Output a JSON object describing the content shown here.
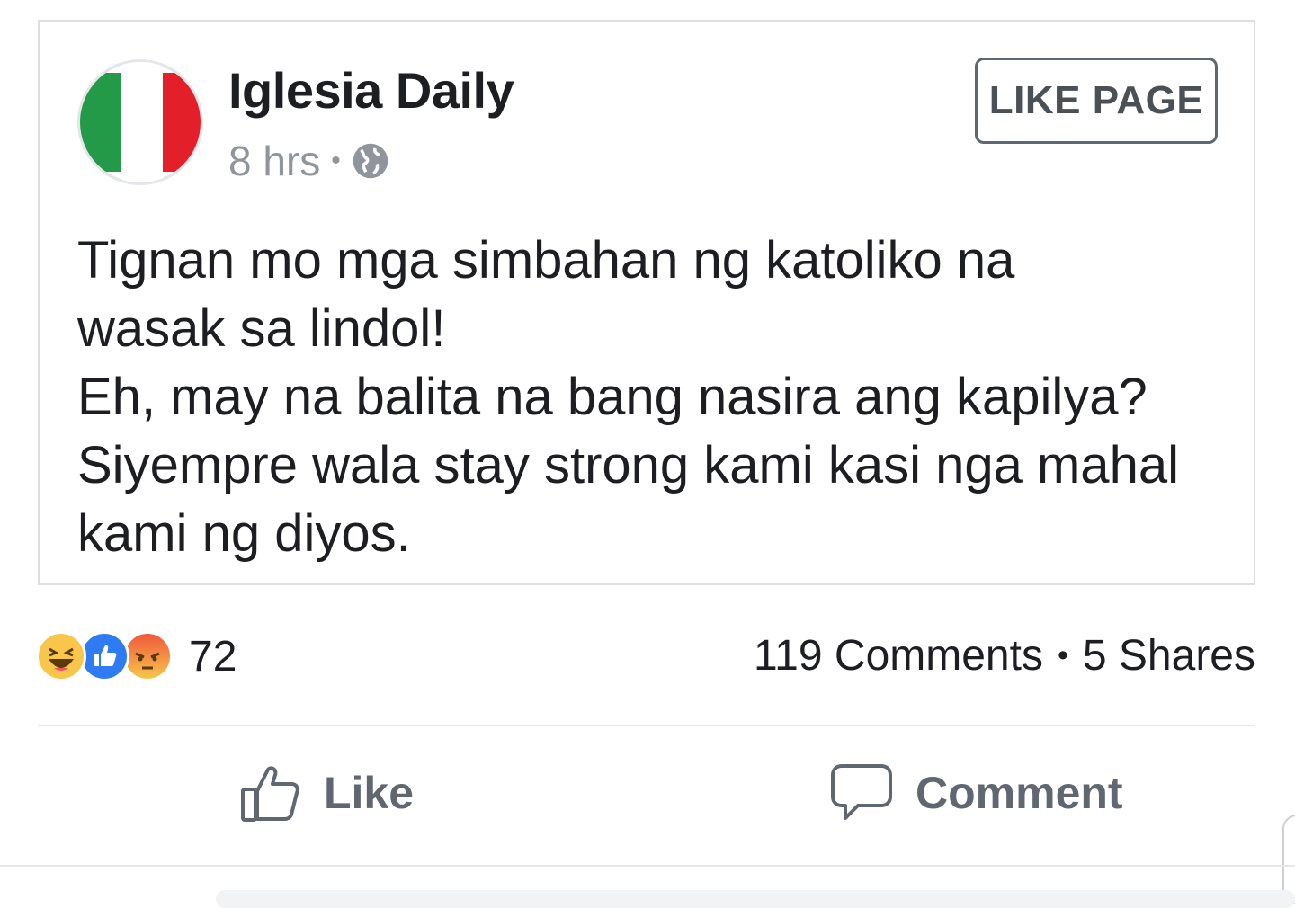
{
  "post": {
    "page_name": "Iglesia Daily",
    "time": "8 hrs",
    "separator": "•",
    "privacy_icon": "globe-icon",
    "like_page_label": "LIKE PAGE",
    "text_lines": [
      "Tignan mo mga simbahan ng katoliko na",
      "wasak sa lindol!",
      "Eh, may na balita na bang nasira ang kapilya?",
      "Siyempre wala stay strong kami kasi nga mahal",
      "kami ng diyos."
    ]
  },
  "engagement": {
    "reaction_icons": [
      "haha-icon",
      "like-icon",
      "angry-icon"
    ],
    "reaction_count": "72",
    "comments": "119 Comments",
    "separator": "•",
    "shares": "5 Shares"
  },
  "actions": {
    "like_label": "Like",
    "comment_label": "Comment"
  },
  "colors": {
    "like_blue": "#2f7bf4",
    "haha_yellow": "#f7c64a",
    "angry_red": "#f0583c",
    "flag_green": "#239a48",
    "flag_red": "#e3202a",
    "muted_text": "#90949c",
    "action_gray": "#606770"
  }
}
